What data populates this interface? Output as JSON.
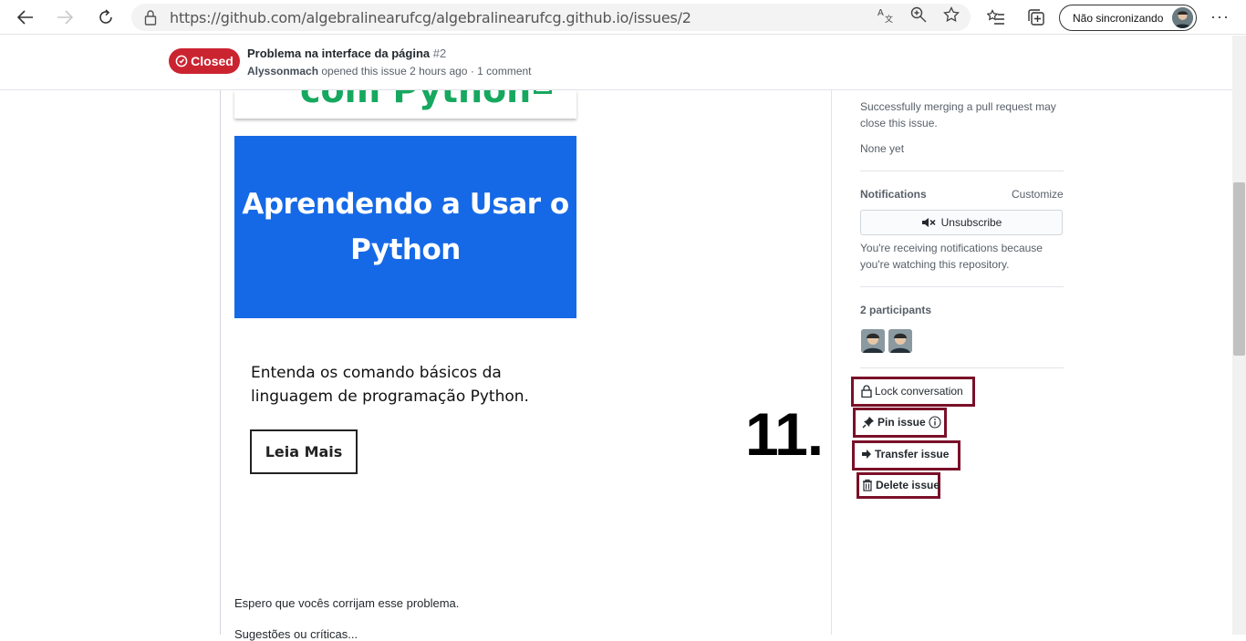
{
  "browser": {
    "url": "https://github.com/algebralinearufcg/algebralinearufcg.github.io/issues/2",
    "profile_label": "Não sincronizando",
    "more_label": "···"
  },
  "issue": {
    "status": "Closed",
    "title": "Problema na interface da página",
    "number": "#2",
    "author": "Alyssonmach",
    "meta": " opened this issue 2 hours ago · 1 comment"
  },
  "content": {
    "cut_title": "com Python",
    "card_title": "Aprendendo a Usar o Python",
    "description": "Entenda os comando básicos da linguagem de programação Python.",
    "button_label": "Leia Mais",
    "comment_line1": "Espero que vocês corrijam esse problema.",
    "comment_line2": "Sugestões ou críticas..."
  },
  "step": {
    "label": "11."
  },
  "sidebar": {
    "linked_pr_text": "Successfully merging a pull request may close this issue.",
    "none_yet": "None yet",
    "notifications_heading": "Notifications",
    "customize": "Customize",
    "unsubscribe": "Unsubscribe",
    "notif_reason": "You're receiving notifications because you're watching this repository.",
    "participants_heading": "2 participants",
    "lock": "Lock conversation",
    "pin": "Pin issue",
    "transfer": "Transfer issue",
    "delete": "Delete issue"
  },
  "colors": {
    "closed": "#cb2431",
    "card_blue": "#1569e6",
    "highlight": "#7a1029"
  }
}
